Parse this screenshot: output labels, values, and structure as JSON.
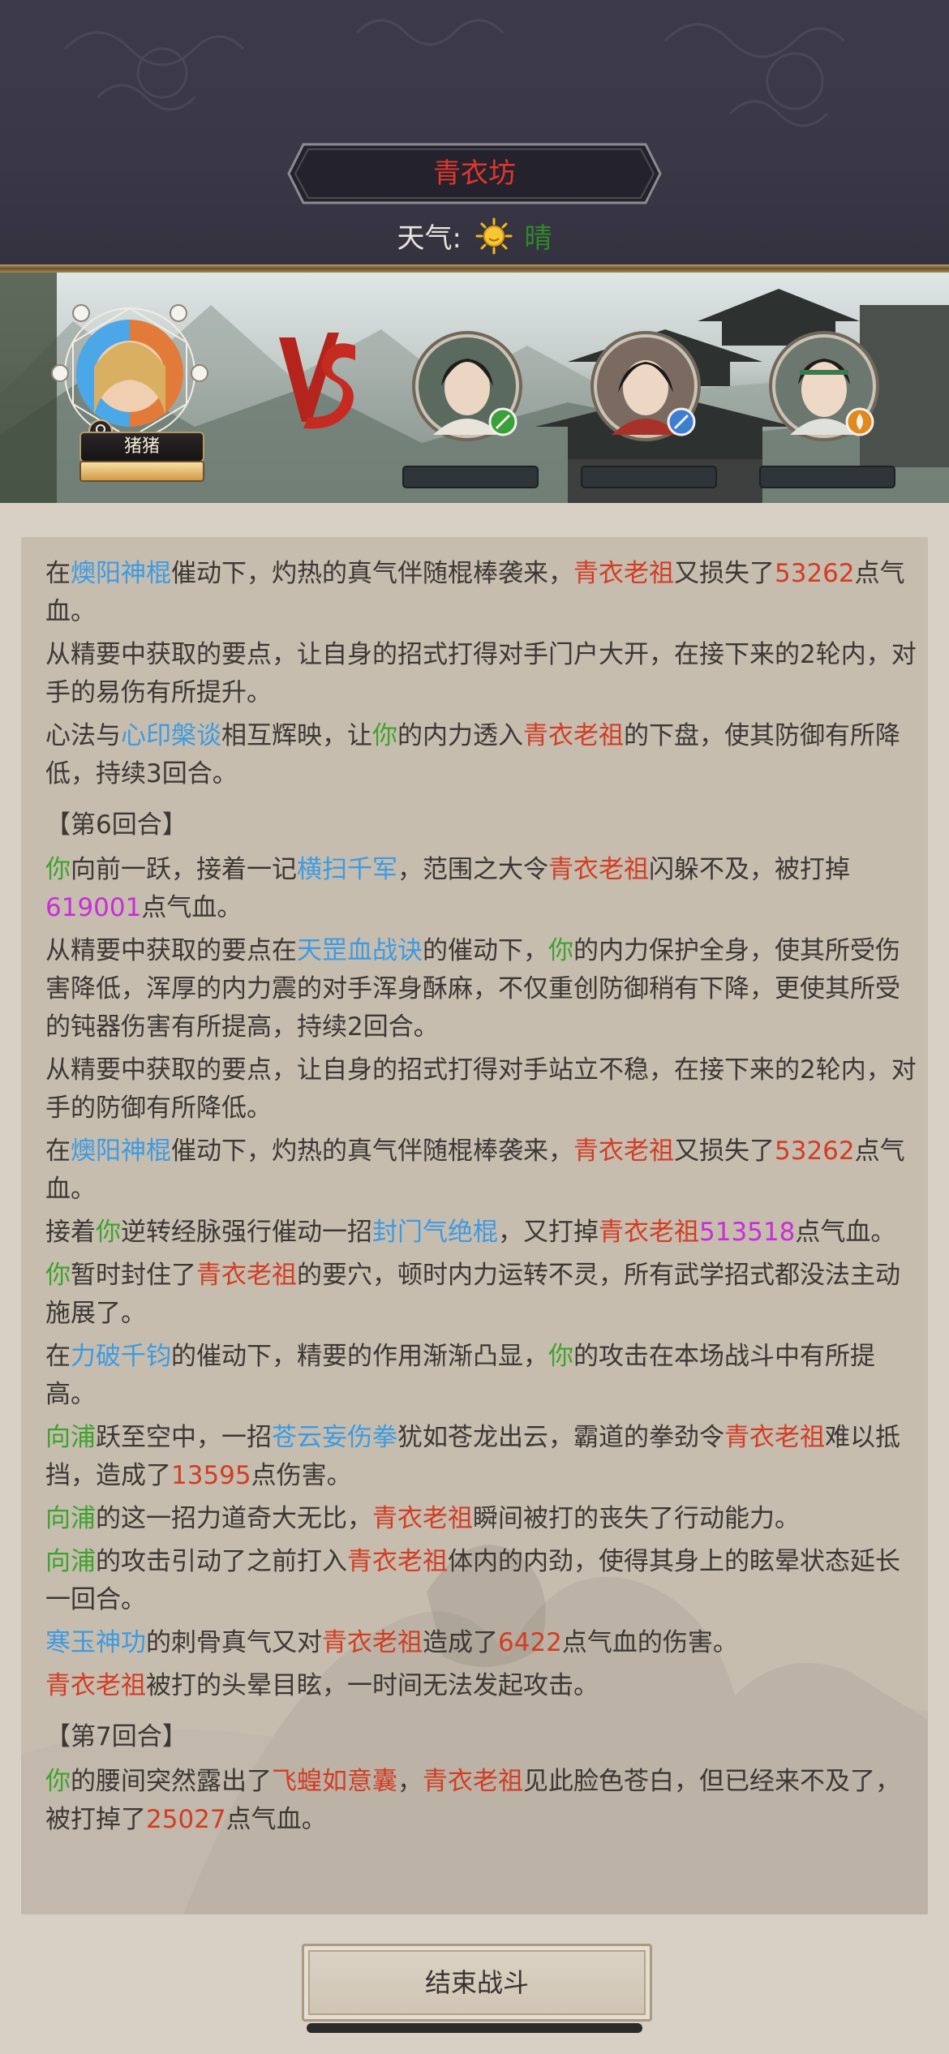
{
  "header": {
    "title": "青衣坊",
    "weather_label": "天气:",
    "weather_value": "晴",
    "weather_icon": "sun-icon"
  },
  "battle": {
    "player": {
      "name": "猪猪",
      "hp_fraction": 1.0,
      "gender_icon": "female-icon"
    },
    "vs_icon": "vs-emblem-icon",
    "enemies": [
      {
        "badge_icon": "green-sword-badge-icon",
        "badge_color": "#3aa03a"
      },
      {
        "badge_icon": "blue-sword-badge-icon",
        "badge_color": "#3c7fd0"
      },
      {
        "badge_icon": "orange-flame-badge-icon",
        "badge_color": "#e08a1e"
      }
    ]
  },
  "log": {
    "entries": [
      {
        "type": "line",
        "segments": [
          {
            "t": "在",
            "c": ""
          },
          {
            "t": "燠阳神棍",
            "c": "blue"
          },
          {
            "t": "催动下，灼热的真气伴随棍棒袭来，",
            "c": ""
          },
          {
            "t": "青衣老祖",
            "c": "red"
          },
          {
            "t": "又损失了",
            "c": ""
          },
          {
            "t": "53262",
            "c": "red"
          },
          {
            "t": "点气血。",
            "c": ""
          }
        ]
      },
      {
        "type": "line",
        "segments": [
          {
            "t": "从精要中获取的要点，让自身的招式打得对手门户大开，在接下来的2轮内，对手的易伤有所提升。",
            "c": ""
          }
        ]
      },
      {
        "type": "line",
        "segments": [
          {
            "t": "心法与",
            "c": ""
          },
          {
            "t": "心印槃谈",
            "c": "blue"
          },
          {
            "t": "相互辉映，让",
            "c": ""
          },
          {
            "t": "你",
            "c": "green"
          },
          {
            "t": "的内力透入",
            "c": ""
          },
          {
            "t": "青衣老祖",
            "c": "red"
          },
          {
            "t": "的下盘，使其防御有所降低，持续3回合。",
            "c": ""
          }
        ]
      },
      {
        "type": "round",
        "segments": [
          {
            "t": "【第6回合】",
            "c": ""
          }
        ]
      },
      {
        "type": "line",
        "segments": [
          {
            "t": "你",
            "c": "green"
          },
          {
            "t": "向前一跃，接着一记",
            "c": ""
          },
          {
            "t": "横扫千军",
            "c": "blue"
          },
          {
            "t": "，范围之大令",
            "c": ""
          },
          {
            "t": "青衣老祖",
            "c": "red"
          },
          {
            "t": "闪躲不及，被打掉",
            "c": ""
          },
          {
            "t": "619001",
            "c": "mag"
          },
          {
            "t": "点气血。",
            "c": ""
          }
        ]
      },
      {
        "type": "line",
        "segments": [
          {
            "t": "从精要中获取的要点在",
            "c": ""
          },
          {
            "t": "天罡血战诀",
            "c": "blue"
          },
          {
            "t": "的催动下，",
            "c": ""
          },
          {
            "t": "你",
            "c": "green"
          },
          {
            "t": "的内力保护全身，使其所受伤害降低，浑厚的内力震的对手浑身酥麻，不仅重创防御稍有下降，更使其所受的钝器伤害有所提高，持续2回合。",
            "c": ""
          }
        ]
      },
      {
        "type": "line",
        "segments": [
          {
            "t": "从精要中获取的要点，让自身的招式打得对手站立不稳，在接下来的2轮内，对手的防御有所降低。",
            "c": ""
          }
        ]
      },
      {
        "type": "line",
        "segments": [
          {
            "t": "在",
            "c": ""
          },
          {
            "t": "燠阳神棍",
            "c": "blue"
          },
          {
            "t": "催动下，灼热的真气伴随棍棒袭来，",
            "c": ""
          },
          {
            "t": "青衣老祖",
            "c": "red"
          },
          {
            "t": "又损失了",
            "c": ""
          },
          {
            "t": "53262",
            "c": "red"
          },
          {
            "t": "点气血。",
            "c": ""
          }
        ]
      },
      {
        "type": "line",
        "segments": [
          {
            "t": "接着",
            "c": ""
          },
          {
            "t": "你",
            "c": "green"
          },
          {
            "t": "逆转经脉强行催动一招",
            "c": ""
          },
          {
            "t": "封门气绝棍",
            "c": "blue"
          },
          {
            "t": "，又打掉",
            "c": ""
          },
          {
            "t": "青衣老祖",
            "c": "red"
          },
          {
            "t": "513518",
            "c": "mag"
          },
          {
            "t": "点气血。",
            "c": ""
          }
        ]
      },
      {
        "type": "line",
        "segments": [
          {
            "t": "你",
            "c": "green"
          },
          {
            "t": "暂时封住了",
            "c": ""
          },
          {
            "t": "青衣老祖",
            "c": "red"
          },
          {
            "t": "的要穴，顿时内力运转不灵，所有武学招式都没法主动施展了。",
            "c": ""
          }
        ]
      },
      {
        "type": "line",
        "segments": [
          {
            "t": "在",
            "c": ""
          },
          {
            "t": "力破千钧",
            "c": "blue"
          },
          {
            "t": "的催动下，精要的作用渐渐凸显，",
            "c": ""
          },
          {
            "t": "你",
            "c": "green"
          },
          {
            "t": "的攻击在本场战斗中有所提高。",
            "c": ""
          }
        ]
      },
      {
        "type": "line",
        "segments": [
          {
            "t": "向浦",
            "c": "green"
          },
          {
            "t": "跃至空中，一招",
            "c": ""
          },
          {
            "t": "苍云妄伤拳",
            "c": "blue"
          },
          {
            "t": "犹如苍龙出云，霸道的拳劲令",
            "c": ""
          },
          {
            "t": "青衣老祖",
            "c": "red"
          },
          {
            "t": "难以抵挡，造成了",
            "c": ""
          },
          {
            "t": "13595",
            "c": "red"
          },
          {
            "t": "点伤害。",
            "c": ""
          }
        ]
      },
      {
        "type": "line",
        "segments": [
          {
            "t": "向浦",
            "c": "green"
          },
          {
            "t": "的这一招力道奇大无比，",
            "c": ""
          },
          {
            "t": "青衣老祖",
            "c": "red"
          },
          {
            "t": "瞬间被打的丧失了行动能力。",
            "c": ""
          }
        ]
      },
      {
        "type": "line",
        "segments": [
          {
            "t": "向浦",
            "c": "green"
          },
          {
            "t": "的攻击引动了之前打入",
            "c": ""
          },
          {
            "t": "青衣老祖",
            "c": "red"
          },
          {
            "t": "体内的内劲，使得其身上的眩晕状态延长一回合。",
            "c": ""
          }
        ]
      },
      {
        "type": "line",
        "segments": [
          {
            "t": "寒玉神功",
            "c": "blue"
          },
          {
            "t": "的刺骨真气又对",
            "c": ""
          },
          {
            "t": "青衣老祖",
            "c": "red"
          },
          {
            "t": "造成了",
            "c": ""
          },
          {
            "t": "6422",
            "c": "red"
          },
          {
            "t": "点气血的伤害。",
            "c": ""
          }
        ]
      },
      {
        "type": "line",
        "segments": [
          {
            "t": "青衣老祖",
            "c": "red"
          },
          {
            "t": "被打的头晕目眩，一时间无法发起攻击。",
            "c": ""
          }
        ]
      },
      {
        "type": "round",
        "segments": [
          {
            "t": "【第7回合】",
            "c": ""
          }
        ]
      },
      {
        "type": "line",
        "segments": [
          {
            "t": "你",
            "c": "green"
          },
          {
            "t": "的腰间突然露出了",
            "c": ""
          },
          {
            "t": "飞蝗如意囊",
            "c": "red"
          },
          {
            "t": "，",
            "c": ""
          },
          {
            "t": "青衣老祖",
            "c": "red"
          },
          {
            "t": "见此脸色苍白，但已经来不及了，被打掉了",
            "c": ""
          },
          {
            "t": "25027",
            "c": "red"
          },
          {
            "t": "点气血。",
            "c": ""
          }
        ]
      }
    ]
  },
  "footer": {
    "end_button_label": "结束战斗"
  },
  "colors": {
    "enemy_name": "#d23d24",
    "skill": "#3c9be3",
    "ally": "#3da32c",
    "crit_damage": "#c82ed8",
    "title": "#e0372e",
    "weather_value": "#2f8a2a"
  }
}
